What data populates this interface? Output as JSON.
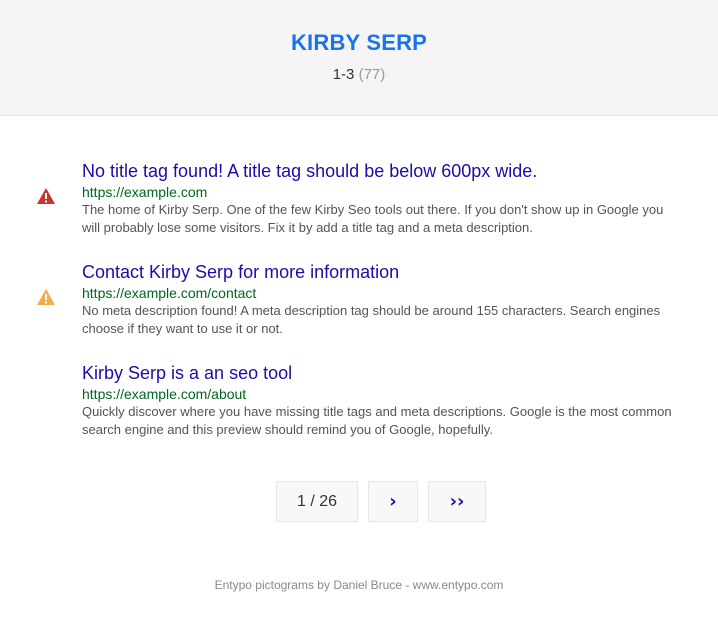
{
  "header": {
    "title": "KIRBY SERP",
    "range": "1-3",
    "total": "(77)"
  },
  "colors": {
    "accent": "#1a73e8",
    "link": "#1a0dab",
    "url": "#006621",
    "error": "#c0392b",
    "warning": "#f0ad4e"
  },
  "results": [
    {
      "status_icon": "error-triangle-icon",
      "title": "No title tag found! A title tag should be below 600px wide.",
      "url": "https://example.com",
      "description": "The home of Kirby Serp. One of the few Kirby Seo tools out there. If you don't show up in Google you will probably lose some visitors. Fix it by add a title tag and a meta description."
    },
    {
      "status_icon": "warning-triangle-icon",
      "title": "Contact Kirby Serp for more information",
      "url": "https://example.com/contact",
      "description": "No meta description found! A meta description tag should be around 155 characters. Search engines choose if they want to use it or not."
    },
    {
      "status_icon": "",
      "title": "Kirby Serp is a an seo tool",
      "url": "https://example.com/about",
      "description": "Quickly discover where you have missing title tags and meta descriptions. Google is the most common search engine and this preview should remind you of Google, hopefully."
    }
  ],
  "pagination": {
    "indicator": "1 / 26",
    "next_label": "›",
    "last_label": "››"
  },
  "footer": {
    "credit": "Entypo pictograms by Daniel Bruce - www.entypo.com"
  }
}
